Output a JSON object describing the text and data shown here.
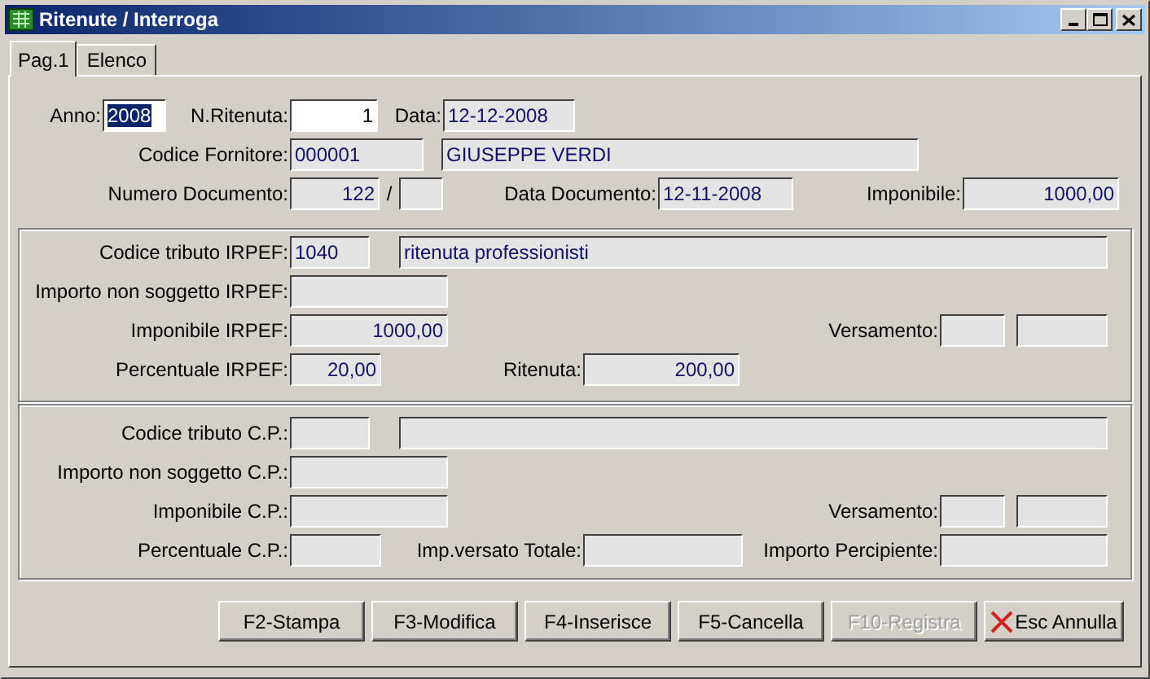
{
  "window": {
    "title": "Ritenute / Interroga"
  },
  "tabs": [
    {
      "label": "Pag.1",
      "selected": true
    },
    {
      "label": "Elenco",
      "selected": false
    }
  ],
  "header": {
    "lines": [
      [
        {
          "label": "Anno:",
          "fields": [
            {
              "value": "2008",
              "editable": true,
              "text_selected": true
            }
          ]
        },
        {
          "label": "N.Ritenuta:",
          "fields": [
            {
              "value": "1",
              "editable": true,
              "text_selected": false
            }
          ]
        },
        {
          "label": "Data:",
          "fields": [
            {
              "value": "12-12-2008",
              "editable": false
            }
          ]
        }
      ],
      [
        {
          "label": "Codice Fornitore:",
          "fields": [
            {
              "value": "000001",
              "editable": false
            },
            {
              "value": "GIUSEPPE VERDI",
              "editable": false
            }
          ]
        }
      ],
      [
        {
          "label": "Numero Documento:",
          "separator": "/",
          "fields": [
            {
              "value": "122",
              "editable": false
            },
            {
              "editable": false
            }
          ]
        },
        {
          "label": "Data Documento:",
          "fields": [
            {
              "value": "12-11-2008",
              "editable": false
            }
          ]
        },
        {
          "label": "Imponibile:",
          "fields": [
            {
              "value": "1000,00",
              "editable": false
            }
          ]
        }
      ]
    ]
  },
  "irpef": {
    "lines": [
      [
        {
          "label": "Codice tributo IRPEF:",
          "fields": [
            {
              "value": "1040",
              "editable": false
            },
            {
              "value": "ritenuta professionisti",
              "editable": false
            }
          ]
        }
      ],
      [
        {
          "label": "Importo non soggetto IRPEF:",
          "fields": [
            {
              "editable": false
            }
          ]
        }
      ],
      [
        {
          "label": "Imponibile IRPEF:",
          "fields": [
            {
              "value": "1000,00",
              "editable": false
            }
          ]
        },
        {
          "label": "Versamento:",
          "fields": [
            {
              "editable": false
            },
            {
              "editable": false
            }
          ]
        }
      ],
      [
        {
          "label": "Percentuale IRPEF:",
          "fields": [
            {
              "value": "20,00",
              "editable": false
            }
          ]
        },
        {
          "label": "Ritenuta:",
          "fields": [
            {
              "value": "200,00",
              "editable": false
            }
          ]
        }
      ]
    ]
  },
  "cp": {
    "lines": [
      [
        {
          "label": "Codice tributo C.P.:",
          "fields": [
            {
              "editable": false
            },
            {
              "editable": false
            }
          ]
        }
      ],
      [
        {
          "label": "Importo non soggetto C.P.:",
          "fields": [
            {
              "editable": false
            }
          ]
        }
      ],
      [
        {
          "label": "Imponibile C.P.:",
          "fields": [
            {
              "editable": false
            }
          ]
        },
        {
          "label": "Versamento:",
          "fields": [
            {
              "editable": false
            },
            {
              "editable": false
            }
          ]
        }
      ],
      [
        {
          "label": "Percentuale C.P.:",
          "fields": [
            {
              "editable": false
            }
          ]
        },
        {
          "label": "Imp.versato Totale:",
          "fields": [
            {
              "editable": false
            }
          ]
        },
        {
          "label": "Importo Percipiente:",
          "fields": [
            {
              "editable": false
            }
          ]
        }
      ]
    ]
  },
  "buttons": [
    {
      "label": "F2-Stampa",
      "disabled": false,
      "kind": "plain"
    },
    {
      "label": "F3-Modifica",
      "disabled": false,
      "kind": "plain"
    },
    {
      "label": "F4-Inserisce",
      "disabled": false,
      "kind": "plain"
    },
    {
      "label": "F5-Cancella",
      "disabled": false,
      "kind": "plain"
    },
    {
      "label": "F10-Registra",
      "disabled": true,
      "kind": "plain"
    },
    {
      "label": "Esc Annulla",
      "disabled": false,
      "kind": "cancel"
    }
  ]
}
